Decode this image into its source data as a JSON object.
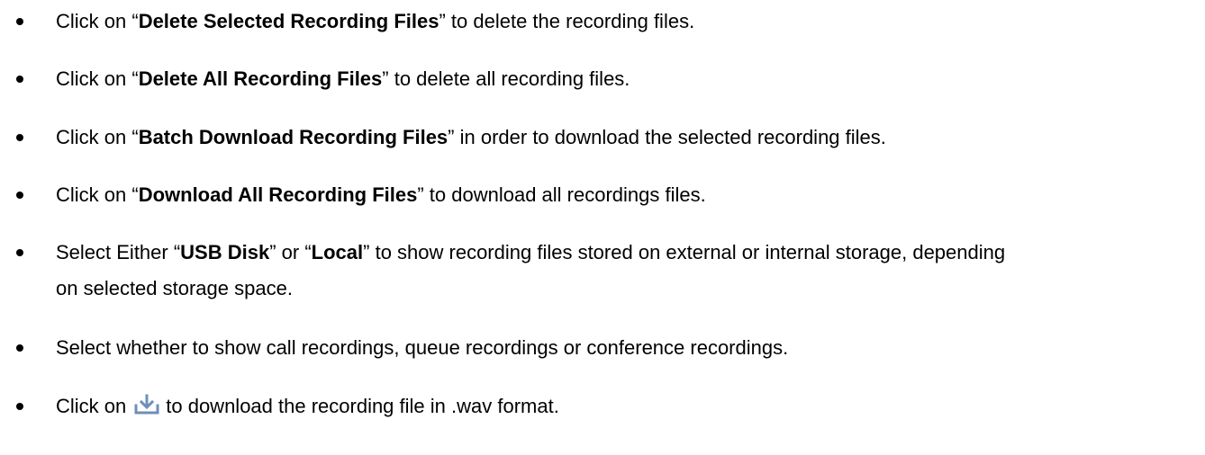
{
  "items": [
    {
      "prefix": "Click on “",
      "bold": "Delete Selected Recording Files",
      "suffix": "” to delete the recording files."
    },
    {
      "prefix": "Click on “",
      "bold": "Delete All Recording Files",
      "suffix": "” to delete all recording files."
    },
    {
      "prefix": "Click on “",
      "bold": "Batch Download Recording Files",
      "suffix": "” in order to download the selected recording files."
    },
    {
      "prefix": "Click on “",
      "bold": "Download All Recording Files",
      "suffix": "” to download all recordings files."
    },
    {
      "prefix": "Select Either “",
      "bold": "USB Disk",
      "middle": "” or “",
      "bold2": "Local",
      "suffix": "” to show recording files stored on external or internal storage, depending",
      "line2": "on selected storage space."
    },
    {
      "text": "Select whether to show call recordings, queue recordings or conference recordings."
    },
    {
      "prefix": "Click on",
      "icon": "download-icon",
      "suffix": "to download the recording file in .wav format."
    }
  ],
  "colors": {
    "text": "#000000",
    "icon": "#6f8fb8"
  }
}
